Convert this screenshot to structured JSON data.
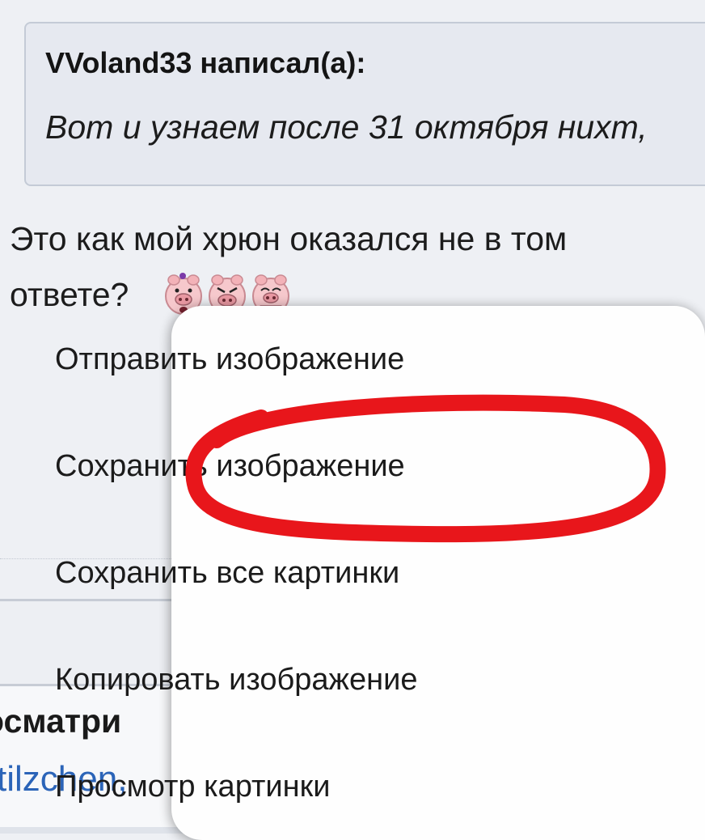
{
  "quote": {
    "author": "VVoland33 написал(а):",
    "text": "Вот и узнаем после 31 октября нихт,"
  },
  "post": {
    "line1": "Это как мой хрюн оказался не в том",
    "line2": "ответе?",
    "smileys": [
      "pig-smiley-icon",
      "pig-smiley-icon",
      "pig-smiley-icon"
    ]
  },
  "viewers": {
    "title": "осматри",
    "user": "tilzchen,"
  },
  "context_menu": {
    "items": [
      {
        "label": "Отправить изображение"
      },
      {
        "label": "Сохранить изображение",
        "highlighted": true
      },
      {
        "label": "Сохранить все картинки"
      },
      {
        "label": "Копировать изображение"
      },
      {
        "label": "Просмотр картинки"
      }
    ]
  },
  "colors": {
    "highlight_marker": "#e8161b",
    "link": "#2b64b8",
    "quote_bg": "#e6e9f0",
    "menu_bg": "#fefefe"
  }
}
